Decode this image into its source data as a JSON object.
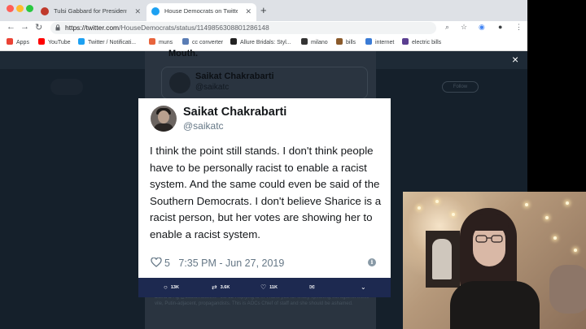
{
  "browser": {
    "tabs": [
      {
        "title": "Tulsi Gabbard for President - Of",
        "fav_color": "#c0392b"
      },
      {
        "title": "House Democrats on Twitter: \"I",
        "fav_color": "#1da1f2"
      }
    ],
    "new_tab": "+",
    "url_host": "https://twitter.com",
    "url_path": "/HouseDemocrats/status/1149856308801286148",
    "bookmarks": [
      {
        "label": "Apps",
        "color": "#ea4335"
      },
      {
        "label": "YouTube",
        "color": "#ff0000"
      },
      {
        "label": "Twitter / Notificati...",
        "color": "#1da1f2"
      },
      {
        "label": "muns",
        "color": "#e8643c"
      },
      {
        "label": "cc converter",
        "color": "#5a7db5"
      },
      {
        "label": "Allure Bridals: Styl...",
        "color": "#222222"
      },
      {
        "label": "milano",
        "color": "#333333"
      },
      {
        "label": "bills",
        "color": "#8a5a2b"
      },
      {
        "label": "internet",
        "color": "#3a7bd5"
      },
      {
        "label": "electric bills",
        "color": "#5b3f91"
      }
    ]
  },
  "backdrop": {
    "mouth_text": "Mouth.",
    "quoted_name": "Saikat Chakrabarti",
    "quoted_handle": "@saikatc",
    "reply_text": "David D'Ag @badtorn8tweet · Jul 12 Replying to ... Thank you for finally speaking out against these vile, Putin-adjacent, propagandists. This is AOCs Chief of staff and she should be ashamed.",
    "button_label": "Follow"
  },
  "tweet": {
    "name": "Saikat Chakrabarti",
    "handle": "@saikatc",
    "text": "I think the point still stands. I don't think people have to be personally racist to enable a racist system. And the same could even be said of the Southern Democrats. I don't believe Sharice is a racist person, but her votes are showing her to enable a racist system.",
    "likes": "5",
    "timestamp": "7:35 PM - Jun 27, 2019"
  },
  "actions": {
    "replies": "13K",
    "retweets": "3.6K",
    "likes": "11K"
  },
  "lightbox": {
    "close": "×"
  }
}
